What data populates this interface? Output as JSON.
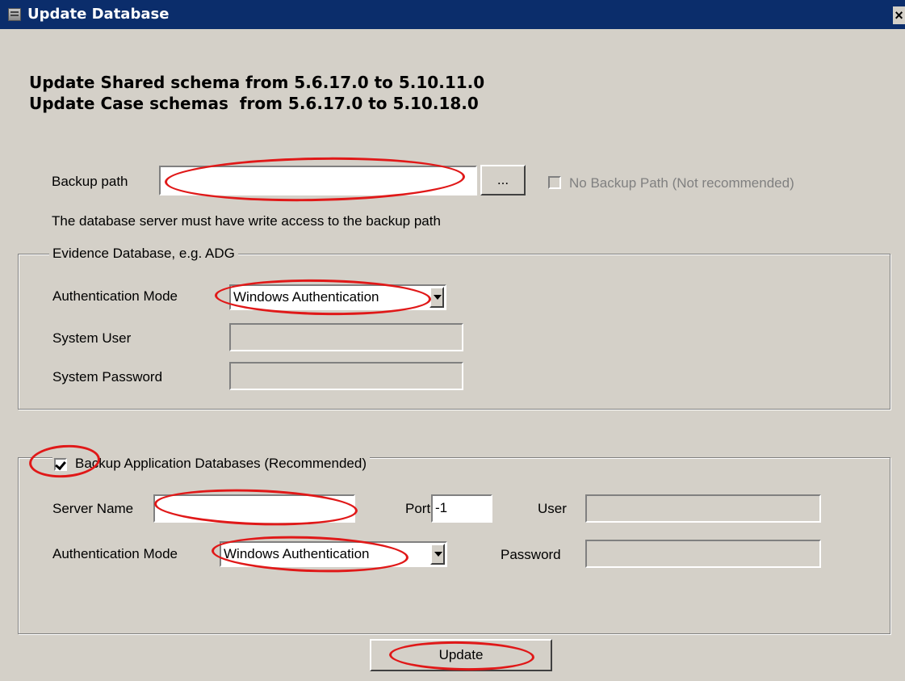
{
  "window": {
    "title": "Update Database",
    "close_glyph": "×"
  },
  "heading": {
    "line1": "Update Shared schema from 5.6.17.0 to 5.10.11.0",
    "line2": "Update Case schemas  from 5.6.17.0 to 5.10.18.0"
  },
  "backup": {
    "label": "Backup path",
    "value": "",
    "browse_label": "...",
    "no_backup_label": "No Backup Path (Not recommended)",
    "no_backup_checked": false,
    "note": "The database server must have write access to the backup path"
  },
  "evidence": {
    "group_label": "Evidence Database, e.g. ADG",
    "auth_mode_label": "Authentication Mode",
    "auth_mode_value": "Windows Authentication",
    "system_user_label": "System User",
    "system_user_value": "",
    "system_password_label": "System Password",
    "system_password_value": ""
  },
  "app_backup": {
    "group_label": "Backup Application Databases (Recommended)",
    "checked": true,
    "server_name_label": "Server Name",
    "server_name_value": "",
    "port_label": "Port",
    "port_value": "-1",
    "user_label": "User",
    "user_value": "",
    "auth_mode_label": "Authentication Mode",
    "auth_mode_value": "Windows Authentication",
    "password_label": "Password",
    "password_value": ""
  },
  "actions": {
    "update_label": "Update"
  },
  "annotation_color": "#e01818"
}
